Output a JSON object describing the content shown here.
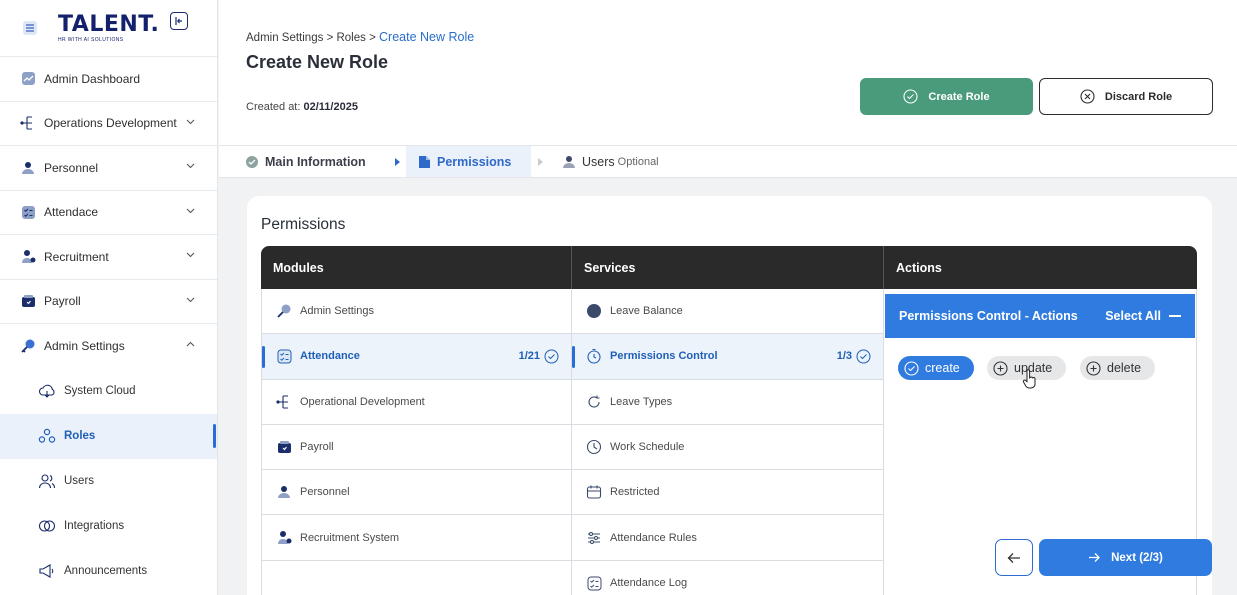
{
  "brand": {
    "name": "TALENT.",
    "tagline": "HR WITH AI SOLUTIONS"
  },
  "sidebar": {
    "items": [
      {
        "label": "Admin Dashboard",
        "icon": "chart-icon"
      },
      {
        "label": "Operations Development",
        "icon": "tree-icon"
      },
      {
        "label": "Personnel",
        "icon": "people-icon"
      },
      {
        "label": "Attendace",
        "icon": "checklist-icon"
      },
      {
        "label": "Recruitment",
        "icon": "user-plus-icon"
      },
      {
        "label": "Payroll",
        "icon": "wallet-icon"
      },
      {
        "label": "Admin Settings",
        "icon": "key-icon"
      }
    ],
    "sub_items": [
      {
        "label": "System Cloud",
        "icon": "cloud-icon"
      },
      {
        "label": "Roles",
        "icon": "roles-icon"
      },
      {
        "label": "Users",
        "icon": "users-icon"
      },
      {
        "label": "Integrations",
        "icon": "integrations-icon"
      },
      {
        "label": "Announcements",
        "icon": "megaphone-icon"
      }
    ]
  },
  "header": {
    "crumb_1": "Admin Settings",
    "crumb_sep": ">",
    "crumb_2": "Roles",
    "crumb_3": "Create New Role",
    "title": "Create New Role",
    "created_label": "Created at:",
    "created_value": "02/11/2025",
    "create_btn": "Create Role",
    "discard_btn": "Discard Role"
  },
  "steps": {
    "step_1": "Main Information",
    "step_2": "Permissions",
    "step_3": "Users",
    "step_3_opt": "Optional"
  },
  "permissions": {
    "title": "Permissions",
    "headers": {
      "modules": "Modules",
      "services": "Services",
      "actions": "Actions"
    },
    "modules": [
      {
        "label": "Admin Settings"
      },
      {
        "label": "Attendance",
        "count": "1/21"
      },
      {
        "label": "Operational Development"
      },
      {
        "label": "Payroll"
      },
      {
        "label": "Personnel"
      },
      {
        "label": "Recruitment System"
      }
    ],
    "services": [
      {
        "label": "Leave Balance"
      },
      {
        "label": "Permissions Control",
        "count": "1/3"
      },
      {
        "label": "Leave Types"
      },
      {
        "label": "Work Schedule"
      },
      {
        "label": "Restricted"
      },
      {
        "label": "Attendance Rules"
      },
      {
        "label": "Attendance Log"
      }
    ],
    "actions_bar": "Permissions Control - Actions",
    "select_all": "Select All",
    "chips": {
      "create": "create",
      "update": "update",
      "delete": "delete"
    }
  },
  "footer": {
    "next": "Next (2/3)"
  },
  "colors": {
    "primary": "#2f7be0",
    "success": "#4a9b7c",
    "dark": "#2a2a2a"
  }
}
